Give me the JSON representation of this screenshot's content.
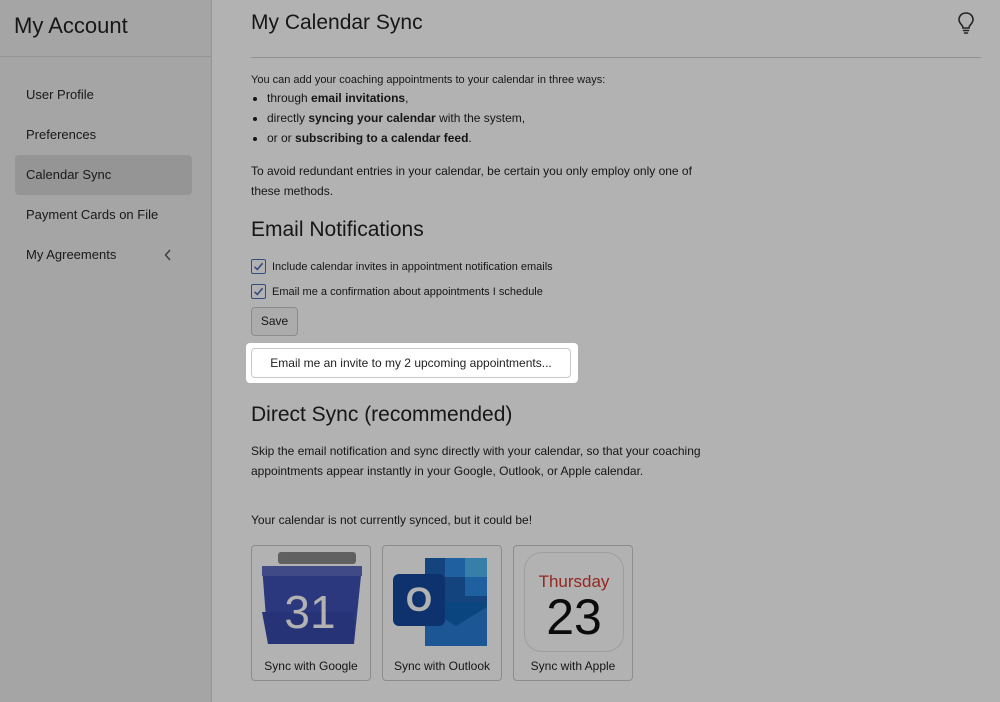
{
  "sidebar": {
    "title": "My Account",
    "items": [
      {
        "label": "User Profile",
        "active": false
      },
      {
        "label": "Preferences",
        "active": false
      },
      {
        "label": "Calendar Sync",
        "active": true
      },
      {
        "label": "Payment Cards on File",
        "active": false
      },
      {
        "label": "My Agreements",
        "active": false,
        "icon": "chevron-left-icon"
      }
    ]
  },
  "header": {
    "title": "My Calendar Sync",
    "help_icon": "lightbulb-icon"
  },
  "intro": {
    "lead": "You can add your coaching appointments to your calendar in three ways:",
    "bullets": [
      {
        "pre": "through ",
        "bold": "email invitations",
        "post": ","
      },
      {
        "pre": "directly ",
        "bold": "syncing your calendar",
        "post": " with the system,"
      },
      {
        "pre": "or or ",
        "bold": "subscribing to a calendar feed",
        "post": "."
      }
    ],
    "avoid": "To avoid redundant entries in your calendar, be certain you only employ only one of these methods."
  },
  "email_notifications": {
    "heading": "Email Notifications",
    "checkboxes": [
      {
        "label": "Include calendar invites in appointment notification emails",
        "checked": true
      },
      {
        "label": "Email me a confirmation about appointments I schedule",
        "checked": true
      }
    ],
    "save_label": "Save",
    "invite_label": "Email me an invite to my 2 upcoming appointments..."
  },
  "direct_sync": {
    "heading": "Direct Sync (recommended)",
    "description": "Skip the email notification and sync directly with your calendar, so that your coaching appointments appear instantly in your Google, Outlook, or Apple calendar.",
    "status": "Your calendar is not currently synced, but it could be!",
    "options": [
      {
        "label": "Sync with Google",
        "icon": "google-calendar-icon",
        "icon_text": "31"
      },
      {
        "label": "Sync with Outlook",
        "icon": "outlook-icon",
        "icon_text": "O"
      },
      {
        "label": "Sync with Apple",
        "icon": "apple-calendar-icon",
        "day": "Thursday",
        "date": "23"
      }
    ]
  },
  "colors": {
    "accent": "#4b6fb8",
    "apple_red": "#d43a2f",
    "google_blue": "#3f51b5",
    "outlook_blue": "#0f64b6"
  }
}
